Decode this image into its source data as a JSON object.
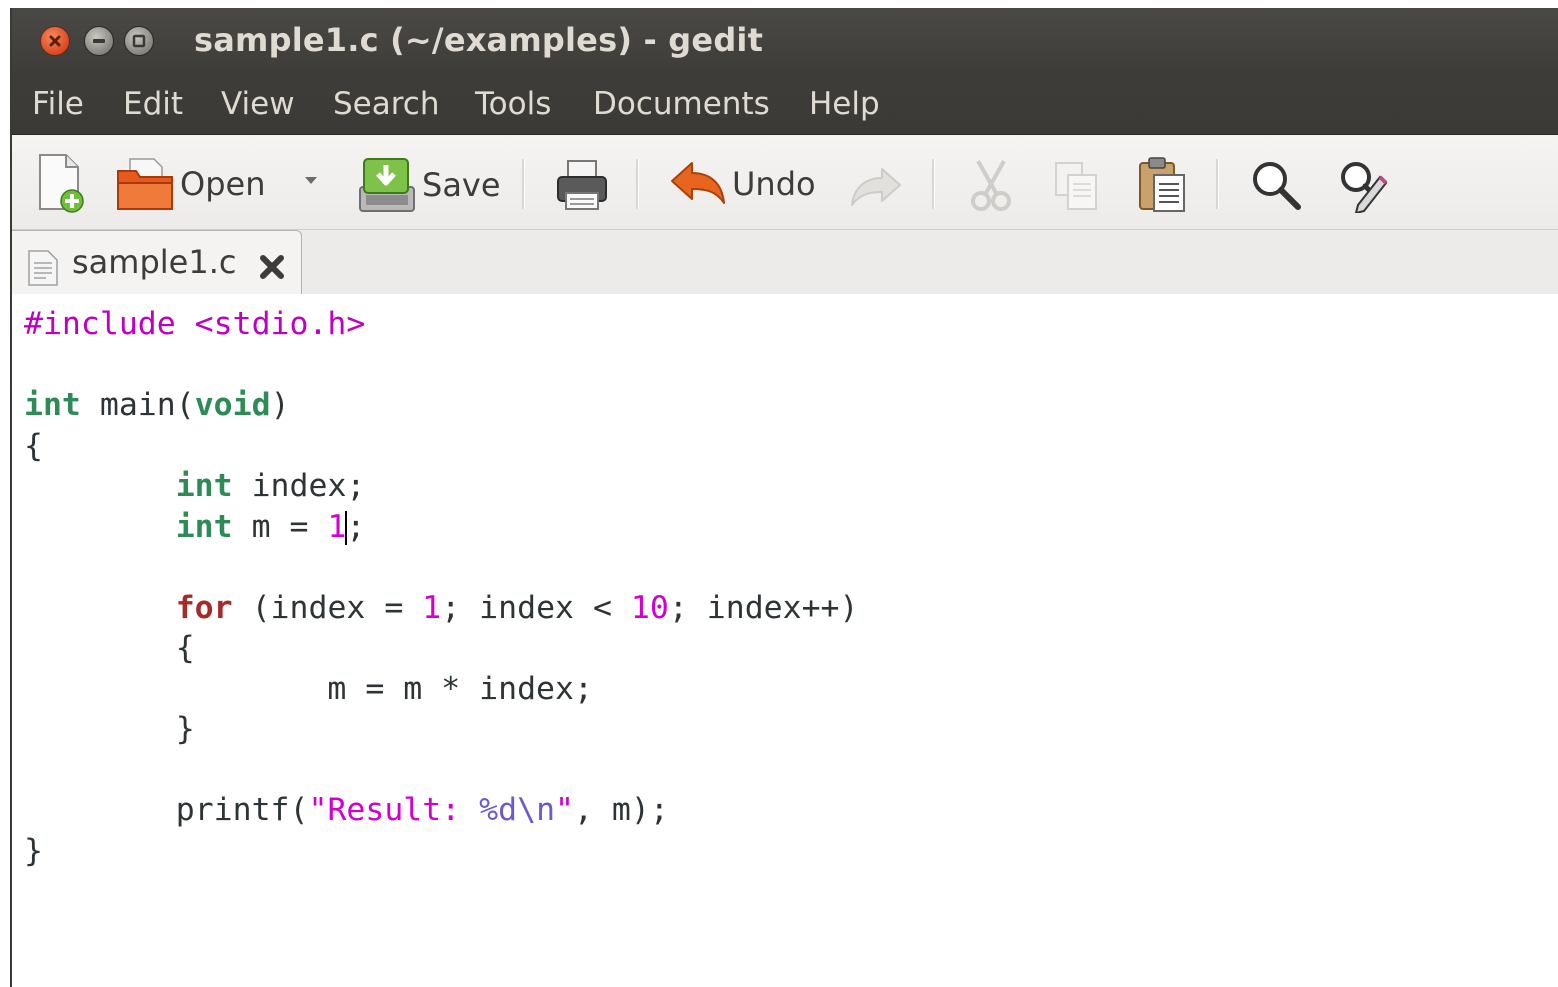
{
  "window": {
    "title": "sample1.c (~/examples) - gedit"
  },
  "menu": [
    "File",
    "Edit",
    "View",
    "Search",
    "Tools",
    "Documents",
    "Help"
  ],
  "toolbar": {
    "open_label": "Open",
    "save_label": "Save",
    "undo_label": "Undo"
  },
  "tabs": [
    {
      "label": "sample1.c"
    }
  ],
  "editor": {
    "lines": [
      {
        "segments": [
          {
            "t": "#include <stdio.h>",
            "c": "pp"
          }
        ]
      },
      {
        "segments": []
      },
      {
        "segments": [
          {
            "t": "int",
            "c": "kw-type"
          },
          {
            "t": " main("
          },
          {
            "t": "void",
            "c": "kw-type"
          },
          {
            "t": ")"
          }
        ]
      },
      {
        "segments": [
          {
            "t": "{"
          }
        ]
      },
      {
        "segments": [
          {
            "t": "        "
          },
          {
            "t": "int",
            "c": "kw-type"
          },
          {
            "t": " index;"
          }
        ]
      },
      {
        "segments": [
          {
            "t": "        "
          },
          {
            "t": "int",
            "c": "kw-type"
          },
          {
            "t": " m = "
          },
          {
            "t": "1",
            "c": "num"
          },
          {
            "t": "",
            "c": "cursor"
          },
          {
            "t": ";"
          }
        ]
      },
      {
        "segments": []
      },
      {
        "segments": [
          {
            "t": "        "
          },
          {
            "t": "for",
            "c": "kw-stmt"
          },
          {
            "t": " (index = "
          },
          {
            "t": "1",
            "c": "num"
          },
          {
            "t": "; index < "
          },
          {
            "t": "10",
            "c": "num"
          },
          {
            "t": "; index++)"
          }
        ]
      },
      {
        "segments": [
          {
            "t": "        {"
          }
        ]
      },
      {
        "segments": [
          {
            "t": "                m = m * index;"
          }
        ]
      },
      {
        "segments": [
          {
            "t": "        }"
          }
        ]
      },
      {
        "segments": []
      },
      {
        "segments": [
          {
            "t": "        printf("
          },
          {
            "t": "\"Result: ",
            "c": "str"
          },
          {
            "t": "%d\\n",
            "c": "esc"
          },
          {
            "t": "\"",
            "c": "str"
          },
          {
            "t": ", m);"
          }
        ]
      },
      {
        "segments": [
          {
            "t": "}"
          }
        ]
      }
    ]
  },
  "colors": {
    "titlebar": "#3d3c38",
    "type_keyword": "#2e8b57",
    "statement_keyword": "#a52a2a",
    "string": "#d000d0",
    "close_button": "#e0502a"
  }
}
